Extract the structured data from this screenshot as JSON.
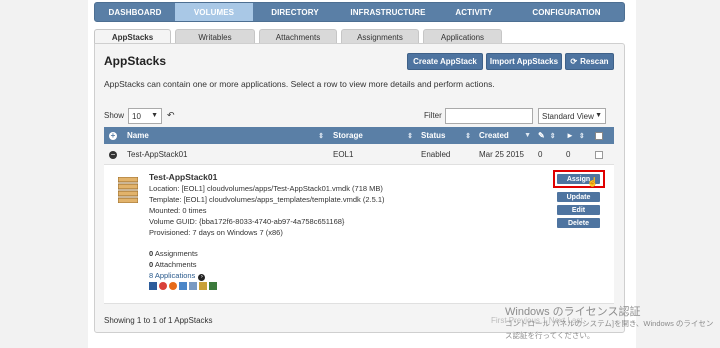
{
  "nav": {
    "items": [
      {
        "label": "DASHBOARD"
      },
      {
        "label": "VOLUMES"
      },
      {
        "label": "DIRECTORY"
      },
      {
        "label": "INFRASTRUCTURE"
      },
      {
        "label": "ACTIVITY"
      },
      {
        "label": "CONFIGURATION"
      }
    ]
  },
  "subtabs": [
    "AppStacks",
    "Writables",
    "Attachments",
    "Assignments",
    "Applications"
  ],
  "panel": {
    "title": "AppStacks",
    "description": "AppStacks can contain one or more applications. Select a row to view more details and perform actions.",
    "buttons": {
      "create": "Create AppStack",
      "import": "Import AppStacks",
      "rescan": "Rescan"
    }
  },
  "toolbar": {
    "show_label": "Show",
    "show_value": "10",
    "filter_label": "Filter",
    "filter_value": "",
    "view_value": "Standard View"
  },
  "table": {
    "columns": {
      "name": "Name",
      "storage": "Storage",
      "status": "Status",
      "created": "Created"
    },
    "rows": [
      {
        "name": "Test-AppStack01",
        "storage": "EOL1",
        "status": "Enabled",
        "created": "Mar 25 2015",
        "count1": "0",
        "count2": "0"
      }
    ]
  },
  "detail": {
    "title": "Test-AppStack01",
    "location": "Location: [EOL1] cloudvolumes/apps/Test-AppStack01.vmdk (718 MB)",
    "template": "Template: [EOL1] cloudvolumes/apps_templates/template.vmdk (2.5.1)",
    "mounted": "Mounted: 0 times",
    "guid": "Volume GUID: {bba172f6-8033-4740-ab97-4a758c651168}",
    "provisioned": "Provisioned: 7 days on Windows 7 (x86)",
    "assignments_count": "0",
    "assignments_label": "Assignments",
    "attachments_count": "0",
    "attachments_label": "Attachments",
    "applications_link": "8 Applications",
    "actions": {
      "assign": "Assign",
      "update": "Update",
      "edit": "Edit",
      "delete": "Delete"
    }
  },
  "footer": {
    "summary": "Showing 1 to 1 of 1 AppStacks",
    "pagination": "First  Previous  1  Next  Last"
  },
  "watermark": {
    "line1": "Windows のライセンス認証",
    "line2": "コントロール パネルのシステム]を開き、Windows のライセンス認証を行ってください。"
  },
  "colors": {
    "nav_bg": "#5a7fa6",
    "nav_active": "#a9c8e6",
    "button_bg": "#4e74a0",
    "highlight_border": "#e00000"
  }
}
